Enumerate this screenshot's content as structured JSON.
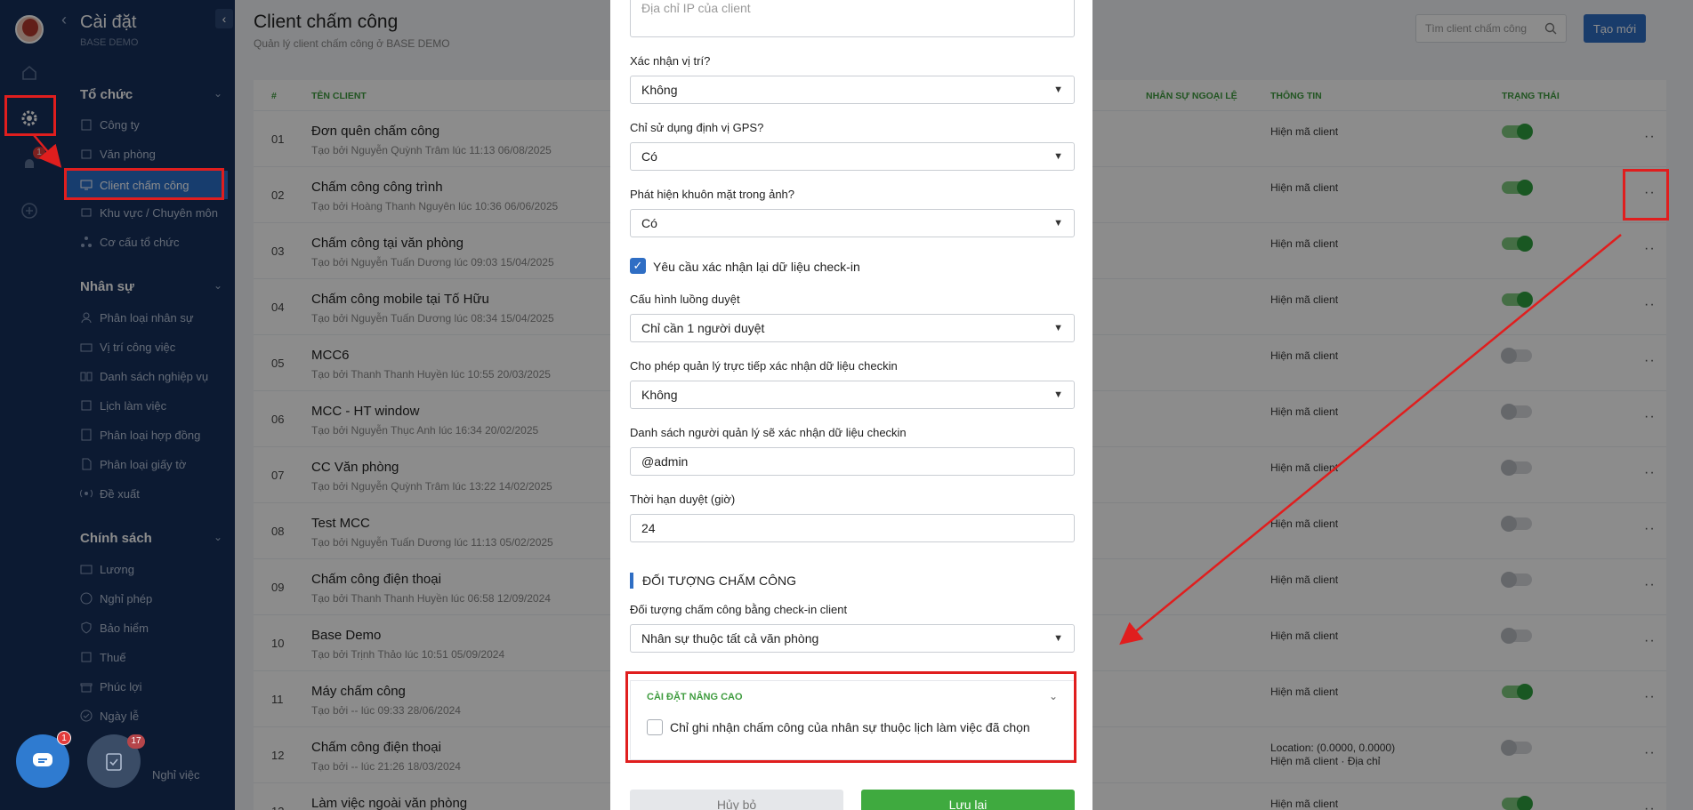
{
  "rail": {
    "notif_count": "1"
  },
  "sidebar": {
    "title": "Cài đặt",
    "subtitle": "BASE DEMO",
    "sections": [
      {
        "label": "Tổ chức",
        "items": [
          "Công ty",
          "Văn phòng",
          "Client chấm công",
          "Khu vực / Chuyên môn",
          "Cơ cấu tổ chức"
        ]
      },
      {
        "label": "Nhân sự",
        "items": [
          "Phân loại nhân sự",
          "Vị trí công việc",
          "Danh sách nghiệp vụ",
          "Lịch làm việc",
          "Phân loại hợp đồng",
          "Phân loại giấy tờ",
          "Đề xuất"
        ]
      },
      {
        "label": "Chính sách",
        "items": [
          "Lương",
          "Nghỉ phép",
          "Bảo hiểm",
          "Thuế",
          "Phúc lợi",
          "Ngày lễ",
          "Nghỉ việc"
        ]
      }
    ],
    "active_item": "Client chấm công"
  },
  "header": {
    "title": "Client chấm công",
    "subtitle": "Quản lý client chấm công ở BASE DEMO",
    "search_placeholder": "Tìm client chấm công",
    "create_label": "Tạo mới"
  },
  "table": {
    "columns": {
      "no": "#",
      "name": "TÊN CLIENT",
      "exceptions": "NHÂN SỰ NGOẠI LỆ",
      "info": "THÔNG TIN",
      "status": "TRẠNG THÁI"
    },
    "rows": [
      {
        "no": "01",
        "name": "Đơn quên chấm công",
        "meta": "Tạo bởi Nguyễn Quỳnh Trâm lúc 11:13 06/08/2025",
        "info": "Hiện mã client",
        "info2": "",
        "on": true
      },
      {
        "no": "02",
        "name": "Chấm công công trình",
        "meta": "Tạo bởi Hoàng Thanh Nguyên lúc 10:36 06/06/2025",
        "info": "Hiện mã client",
        "info2": "",
        "on": true
      },
      {
        "no": "03",
        "name": "Chấm công tại văn phòng",
        "meta": "Tạo bởi Nguyễn Tuấn Dương lúc 09:03 15/04/2025",
        "info": "Hiện mã client",
        "info2": "",
        "on": true
      },
      {
        "no": "04",
        "name": "Chấm công mobile tại Tố Hữu",
        "meta": "Tạo bởi Nguyễn Tuấn Dương lúc 08:34 15/04/2025",
        "info": "Hiện mã client",
        "info2": "",
        "on": true
      },
      {
        "no": "05",
        "name": "MCC6",
        "meta": "Tạo bởi Thanh Thanh Huyền lúc 10:55 20/03/2025",
        "info": "Hiện mã client",
        "info2": "",
        "on": false
      },
      {
        "no": "06",
        "name": "MCC - HT window",
        "meta": "Tạo bởi Nguyễn Thục Anh lúc 16:34 20/02/2025",
        "info": "Hiện mã client",
        "info2": "",
        "on": false
      },
      {
        "no": "07",
        "name": "CC Văn phòng",
        "meta": "Tạo bởi Nguyễn Quỳnh Trâm lúc 13:22 14/02/2025",
        "info": "Hiện mã client",
        "info2": "",
        "on": false
      },
      {
        "no": "08",
        "name": "Test MCC",
        "meta": "Tạo bởi Nguyễn Tuấn Dương lúc 11:13 05/02/2025",
        "info": "Hiện mã client",
        "info2": "",
        "on": false
      },
      {
        "no": "09",
        "name": "Chấm công điện thoại",
        "meta": "Tạo bởi Thanh Thanh Huyền lúc 06:58 12/09/2024",
        "info": "Hiện mã client",
        "info2": "",
        "on": false
      },
      {
        "no": "10",
        "name": "Base Demo",
        "meta": "Tạo bởi Trịnh Thảo lúc 10:51 05/09/2024",
        "info": "Hiện mã client",
        "info2": "",
        "on": false
      },
      {
        "no": "11",
        "name": "Máy chấm công",
        "meta": "Tạo bởi -- lúc 09:33 28/06/2024",
        "info": "Hiện mã client",
        "info2": "",
        "on": true
      },
      {
        "no": "12",
        "name": "Chấm công điện thoại",
        "meta": "Tạo bởi -- lúc 21:26 18/03/2024",
        "info": "Location: (0.0000, 0.0000)",
        "info2": "Hiện mã client · Địa chỉ",
        "on": false
      },
      {
        "no": "13",
        "name": "Làm việc ngoài văn phòng",
        "meta": "",
        "info": "Hiện mã client",
        "info2": "",
        "on": true
      }
    ]
  },
  "modal": {
    "ip_placeholder": "Địa chỉ IP của client",
    "fields": [
      {
        "label": "Xác nhận vị trí?",
        "value": "Không"
      },
      {
        "label": "Chỉ sử dụng định vị GPS?",
        "value": "Có"
      },
      {
        "label": "Phát hiện khuôn mặt trong ảnh?",
        "value": "Có"
      }
    ],
    "recheck_label": "Yêu cầu xác nhận lại dữ liệu check-in",
    "flow_label": "Cấu hình luồng duyệt",
    "flow_value": "Chỉ cần 1 người duyệt",
    "manager_confirm_label": "Cho phép quản lý trực tiếp xác nhận dữ liệu checkin",
    "manager_confirm_value": "Không",
    "manager_list_label": "Danh sách người quản lý sẽ xác nhận dữ liệu checkin",
    "manager_list_value": "@admin",
    "deadline_label": "Thời hạn duyệt (giờ)",
    "deadline_value": "24",
    "section_title": "ĐỐI TƯỢNG CHẤM CÔNG",
    "target_label": "Đối tượng chấm công bằng check-in client",
    "target_value": "Nhân sự thuộc tất cả văn phòng",
    "advanced_title": "CÀI ĐẶT NÂNG CAO",
    "advanced_option": "Chỉ ghi nhận chấm công của nhân sự thuộc lịch làm việc đã chọn",
    "cancel_label": "Hủy bỏ",
    "save_label": "Lưu lại"
  },
  "fabs": {
    "chat_count": "1",
    "tasks_count": "17"
  },
  "colors": {
    "sidebar": "#16305c",
    "primary": "#2f6ec4",
    "success": "#3faa3f",
    "annotation": "#e01e1e"
  }
}
